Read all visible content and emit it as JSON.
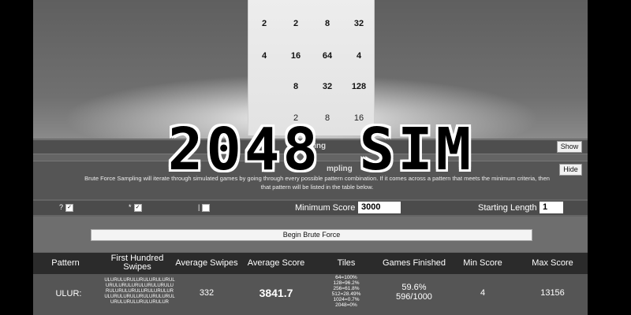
{
  "title": "2048 SIM",
  "board": {
    "tiles": [
      [
        "2",
        "2",
        "8",
        "32"
      ],
      [
        "4",
        "16",
        "64",
        "4"
      ],
      [
        "",
        "8",
        "32",
        "128"
      ],
      [
        "",
        "2",
        "8",
        "16"
      ]
    ]
  },
  "sections": {
    "show_section_label": "ping",
    "show_button": "Show",
    "hide_section_label": "mpling",
    "hide_button": "Hide",
    "description": "Brute Force Sampling will iterate through simulated games by going through every possible pattern combination. If it comes across a pattern that meets the minimum criteria, then that pattern will be listed in the table below."
  },
  "options": {
    "opt1_label": "?",
    "opt2_label": "*",
    "opt3_label": "|",
    "minimum_score_label": "Minimum Score",
    "minimum_score_value": "3000",
    "starting_length_label": "Starting Length",
    "starting_length_value": "1"
  },
  "begin_button": "Begin Brute Force",
  "table": {
    "headers": {
      "pattern": "Pattern",
      "first_hundred": "First Hundred Swipes",
      "avg_swipes": "Average Swipes",
      "avg_score": "Average Score",
      "tiles": "Tiles",
      "games_finished": "Games Finished",
      "min_score": "Min Score",
      "max_score": "Max Score"
    },
    "rows": [
      {
        "pattern": "ULUR:",
        "swipes": "ULURULURULURULURULURULURULURULURULURULURULURULURULURULURULURULURULURULURULURULURULURULURULURULURULURULUR",
        "avg_swipes": "332",
        "avg_score": "3841.7",
        "tiles": [
          "64=100%",
          "128=96.2%",
          "256=61.8%",
          "512=28.49%",
          "1024=0.7%",
          "2048=0%"
        ],
        "games_pct": "59.6%",
        "games_count": "596/1000",
        "min_score": "4",
        "max_score": "13156"
      }
    ]
  }
}
